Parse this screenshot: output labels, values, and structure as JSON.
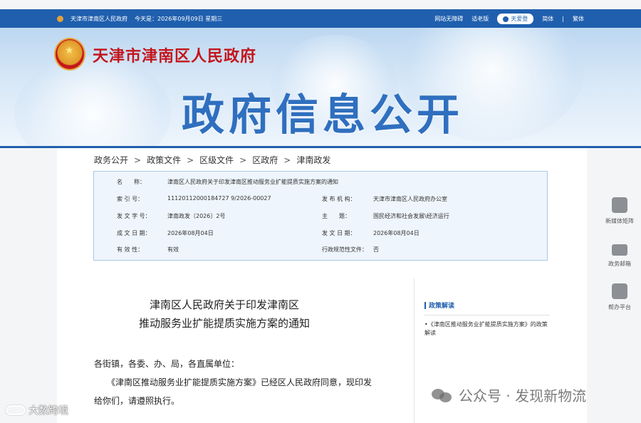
{
  "topbar": {
    "site": "天津市津南区人民政府",
    "date": "今天是：2026年09月09日 星期三",
    "barrier_free": "网站无障碍",
    "elder_version": "适老版",
    "login": "天爱登",
    "lang_simplified": "简体",
    "lang_sep": "|",
    "lang_traditional": "繁体",
    "accent": "#1f5fae"
  },
  "banner": {
    "site_name": "天津市津南区人民政府",
    "title": "政府信息公开",
    "title_color": "#2f6fbf",
    "site_name_color": "#c4161c"
  },
  "breadcrumb": {
    "items": [
      "政务公开",
      "政策文件",
      "区级文件",
      "区政府",
      "津南政发"
    ],
    "separator": ">"
  },
  "meta": {
    "name_label": "名　　称：",
    "name_value": "津南区人民政府关于印发津南区推动服务业扩能提质实施方案的通知",
    "index_label": "索 引 号：",
    "index_value": "11120112000184727 9/2026-00027",
    "publisher_label": "发 布 机 构：",
    "publisher_value": "天津市津南区人民政府办公室",
    "docno_label": "发 文 字 号：",
    "docno_value": "津南政发〔2026〕2号",
    "topic_label": "主　　题：",
    "topic_value": "国民经济和社会发展\\经济运行",
    "created_label": "成 文 日 期：",
    "created_value": "2026年08月04日",
    "issued_label": "发 文 日 期：",
    "issued_value": "2026年08月04日",
    "valid_label": "有 效 性：",
    "valid_value": "有效",
    "normative_label": "行政规范性文件：",
    "normative_value": "否"
  },
  "document": {
    "title_line1": "津南区人民政府关于印发津南区",
    "title_line2": "推动服务业扩能提质实施方案的通知",
    "salutation": "各街镇，各委、办、局，各直属单位：",
    "body_line1": "　　《津南区推动服务业扩能提质实施方案》已经区人民政府同意，现印发",
    "body_line2": "给你们，请遵照执行。"
  },
  "policy_panel": {
    "heading": "政策解读",
    "link": "•《津南区推动服务业扩能提质实施方案》的政策解读"
  },
  "side_tools": [
    {
      "label": "新媒体矩阵",
      "icon": "cube-icon"
    },
    {
      "label": "政务邮箱",
      "icon": "mail-icon"
    },
    {
      "label": "帮办平台",
      "icon": "help-icon"
    }
  ],
  "watermarks": {
    "right": "公众号 · 发现新物流",
    "left": "大数跨境"
  }
}
